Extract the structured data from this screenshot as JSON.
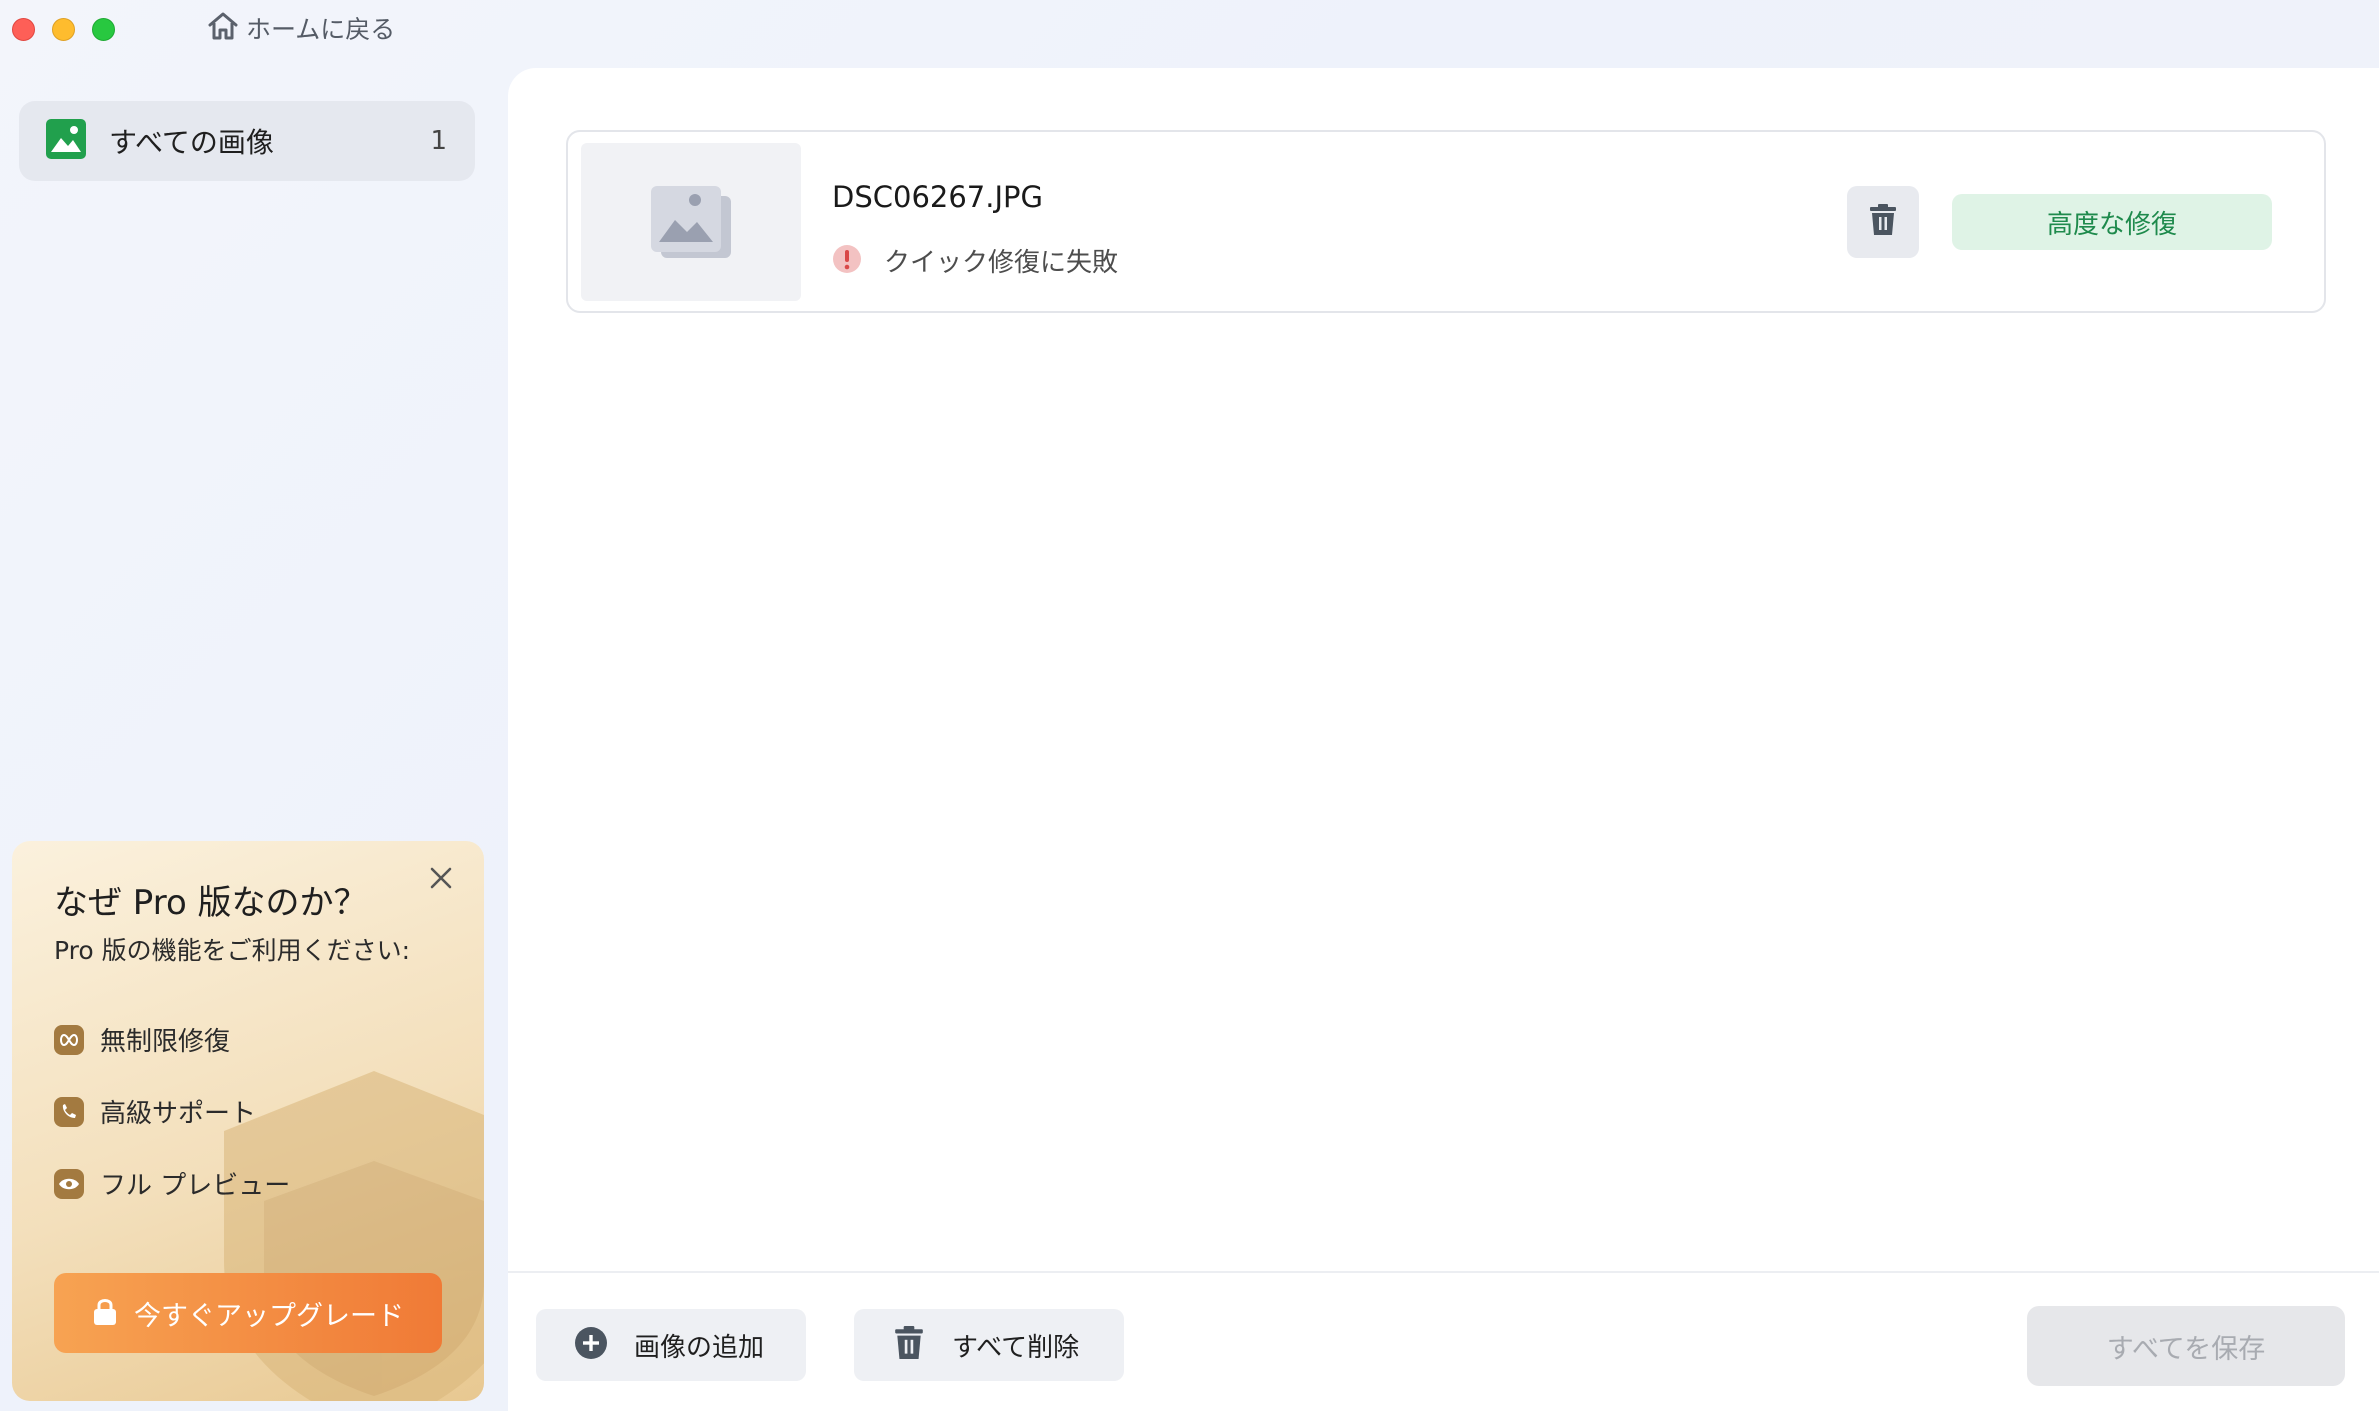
{
  "window": {
    "home_link": "ホームに戻る"
  },
  "sidebar": {
    "items": [
      {
        "label": "すべての画像",
        "count": "1",
        "icon": "image-icon"
      }
    ]
  },
  "promo": {
    "title": "なぜ Pro 版なのか？",
    "subtitle": "Pro 版の機能をご利用ください:",
    "features": [
      {
        "label": "無制限修復",
        "icon": "infinity-icon"
      },
      {
        "label": "高級サポート",
        "icon": "support-icon"
      },
      {
        "label": "フル プレビュー",
        "icon": "eye-icon"
      }
    ],
    "upgrade_label": "今すぐアップグレード"
  },
  "files": [
    {
      "name": "DSC06267.JPG",
      "status": "クイック修復に失敗",
      "action_label": "高度な修復"
    }
  ],
  "footer": {
    "add_label": "画像の追加",
    "delete_all_label": "すべて削除",
    "save_all_label": "すべてを保存"
  },
  "colors": {
    "accent_green": "#1e8a4c",
    "upgrade_orange": "#f07a36",
    "error_red": "#e05a5a"
  }
}
